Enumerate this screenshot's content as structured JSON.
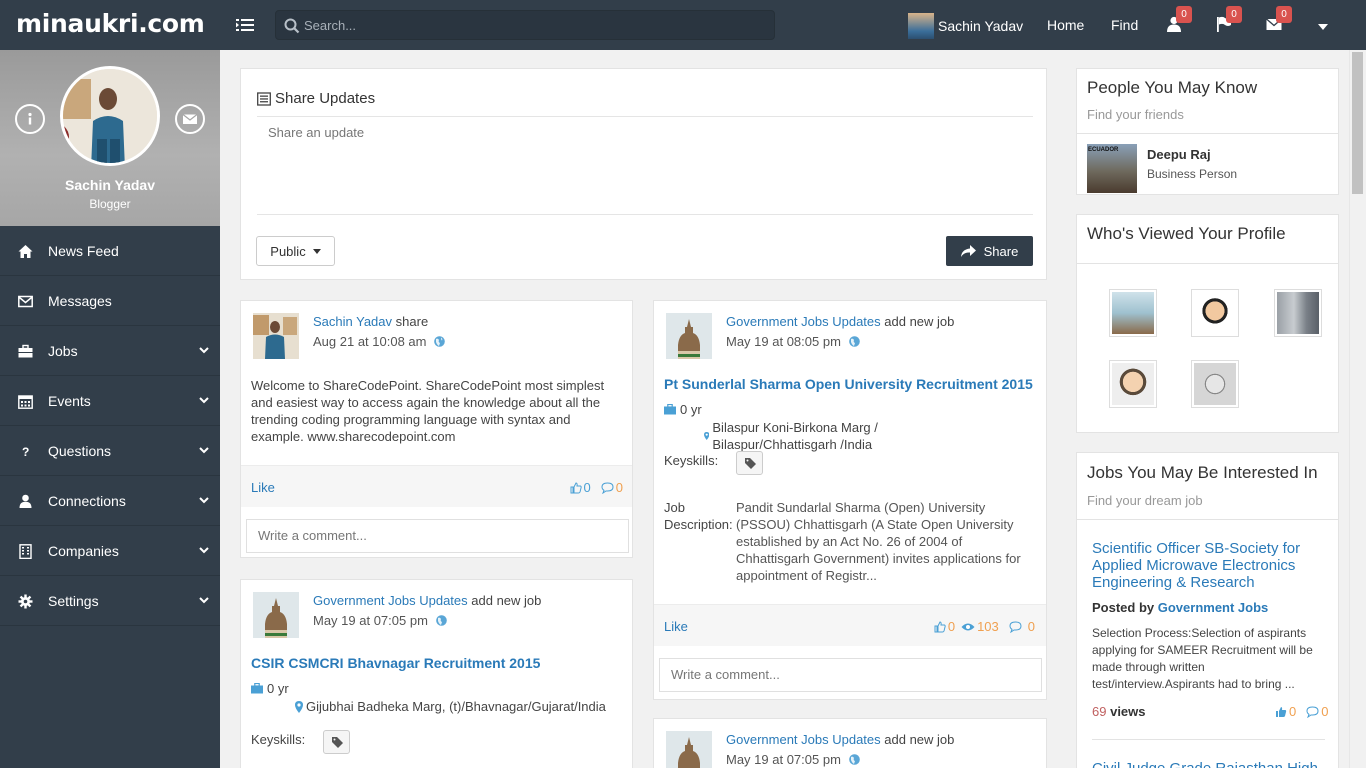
{
  "app": {
    "logo": "minaukri.com"
  },
  "search": {
    "placeholder": "Search..."
  },
  "topnav": {
    "user_name": "Sachin Yadav",
    "home": "Home",
    "find": "Find",
    "badges": {
      "connections": "0",
      "notifications": "0",
      "messages": "0"
    }
  },
  "profile": {
    "name": "Sachin Yadav",
    "role": "Blogger"
  },
  "sidebar": {
    "items": [
      {
        "label": "News Feed",
        "icon": "home-icon"
      },
      {
        "label": "Messages",
        "icon": "envelope-icon"
      },
      {
        "label": "Jobs",
        "icon": "briefcase-icon"
      },
      {
        "label": "Events",
        "icon": "calendar-icon"
      },
      {
        "label": "Questions",
        "icon": "question-icon"
      },
      {
        "label": "Connections",
        "icon": "user-icon"
      },
      {
        "label": "Companies",
        "icon": "building-icon"
      },
      {
        "label": "Settings",
        "icon": "gear-icon"
      }
    ]
  },
  "share": {
    "title": "Share Updates",
    "placeholder": "Share an update",
    "visibility": "Public",
    "button": "Share"
  },
  "posts": {
    "p1": {
      "author": "Sachin Yadav",
      "action": "share",
      "time": "Aug 21 at 10:08 am",
      "text": "Welcome to ShareCodePoint. ShareCodePoint most simplest and easiest way to access again the knowledge about all the trending coding programming language with syntax and example. www.sharecodepoint.com",
      "like": "Like",
      "likes": "0",
      "comments": "0",
      "comment_placeholder": "Write a comment..."
    },
    "p2": {
      "author": "Government Jobs Updates",
      "action": "add new job",
      "time": "May 19 at 07:05 pm",
      "job_title": "CSIR CSMCRI Bhavnagar Recruitment 2015",
      "experience": "0 yr",
      "location": "Gijubhai Badheka Marg, (t)/Bhavnagar/Gujarat/India",
      "keyskills_label": "Keyskills:"
    },
    "p3": {
      "author": "Government Jobs Updates",
      "action": "add new job",
      "time": "May 19 at 08:05 pm",
      "job_title": "Pt Sunderlal Sharma Open University Recruitment 2015",
      "experience": "0 yr",
      "location": "Bilaspur Koni-Birkona Marg / Bilaspur/Chhattisgarh /India",
      "keyskills_label": "Keyskills:",
      "description_label": "Job Description:",
      "description": "Pandit Sundarlal Sharma (Open) University (PSSOU) Chhattisgarh (A State Open University established by an Act No. 26 of 2004 of Chhattisgarh Government) invites applications for appointment of Registr...",
      "like": "Like",
      "likes": "0",
      "views": "103",
      "comments": "0",
      "comment_placeholder": "Write a comment..."
    },
    "p4": {
      "author": "Government Jobs Updates",
      "action": "add new job",
      "time": "May 19 at 07:05 pm"
    }
  },
  "people": {
    "title": "People You May Know",
    "subtitle": "Find your friends",
    "person": {
      "name": "Deepu Raj",
      "role": "Business Person",
      "photo_label": "ECUADOR"
    }
  },
  "viewed": {
    "title": "Who's Viewed Your Profile"
  },
  "jobs": {
    "title": "Jobs You May Be Interested In",
    "subtitle": "Find your dream job",
    "job1": {
      "title": "Scientific Officer SB-Society for Applied Microwave Electronics Engineering & Research",
      "posted_by_label": "Posted by",
      "posted_by": "Government Jobs",
      "text": "Selection Process:Selection of aspirants applying for SAMEER Recruitment will be made through written test/interview.Aspirants had to bring ...",
      "views": "69",
      "views_label": "views",
      "likes": "0",
      "comments": "0"
    },
    "job2": {
      "title": "Civil Judge Grade Rajasthan High"
    }
  }
}
